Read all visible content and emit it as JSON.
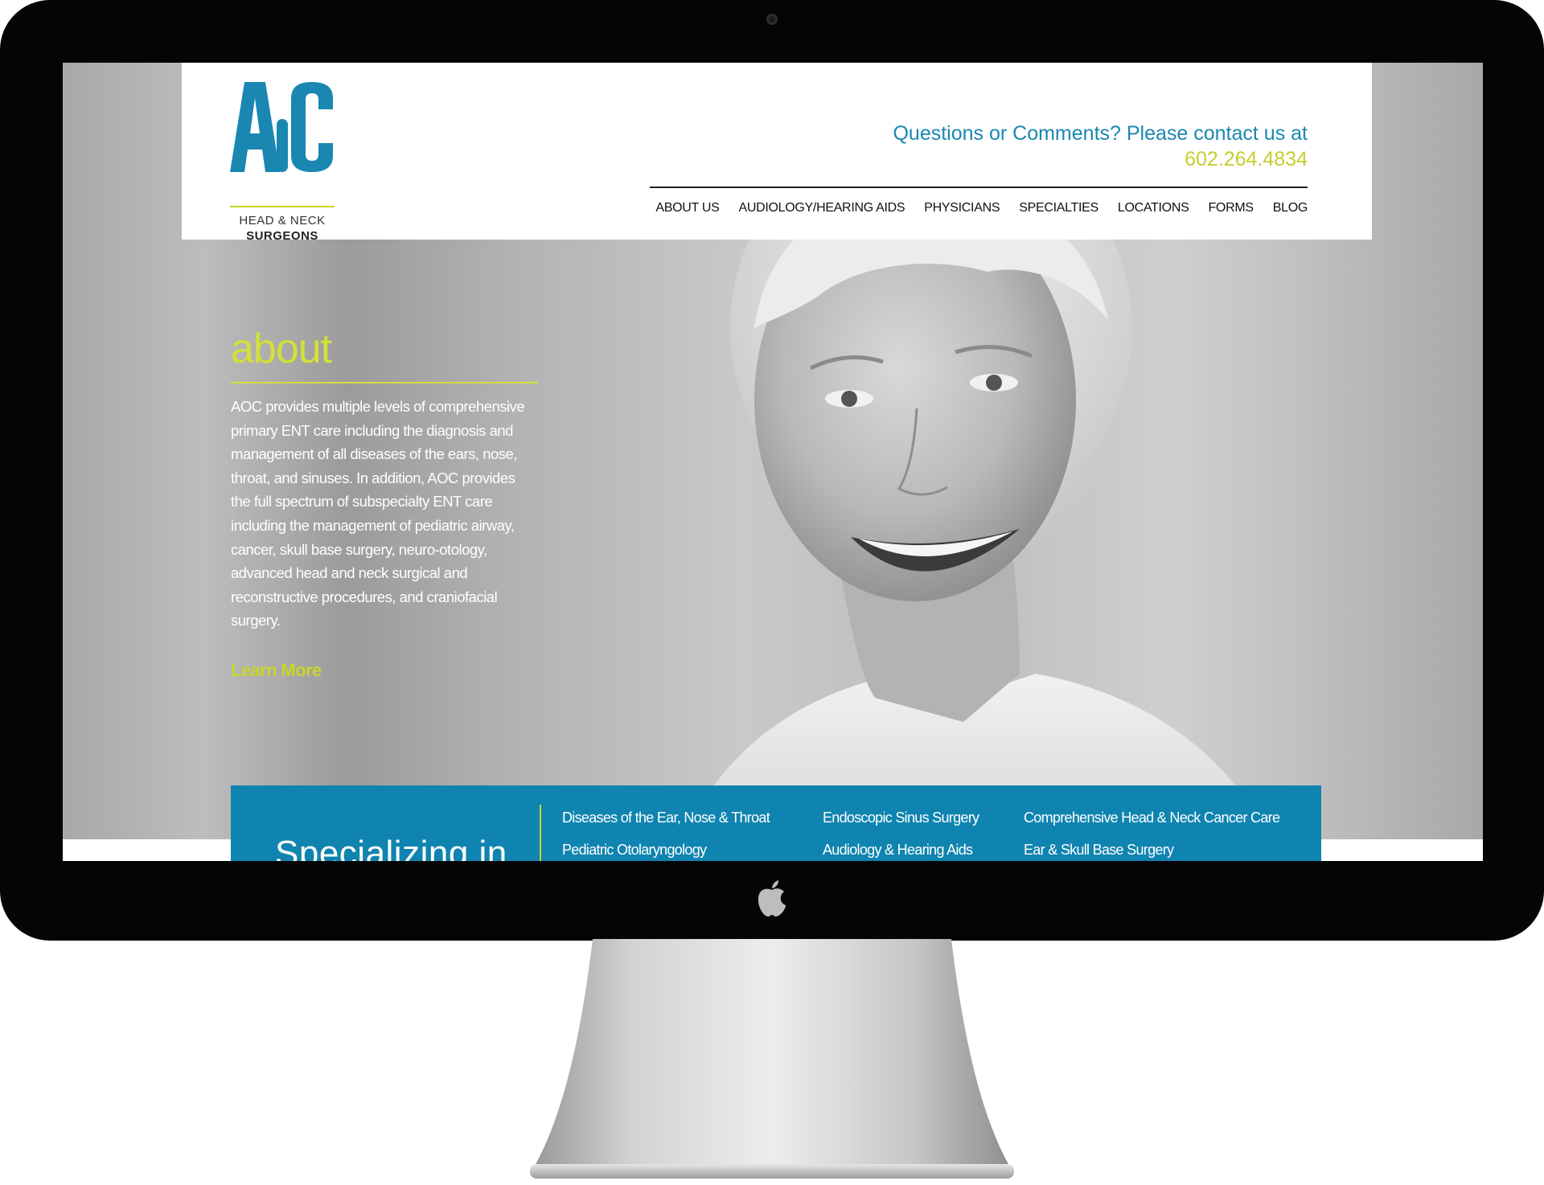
{
  "logo": {
    "mark": "AOC",
    "line1": "HEAD & NECK",
    "line2": "SURGEONS"
  },
  "contact": {
    "question": "Questions or Comments? Please contact us at",
    "phone": "602.264.4834"
  },
  "nav": [
    {
      "label": "ABOUT US"
    },
    {
      "label": "AUDIOLOGY/HEARING AIDS"
    },
    {
      "label": "PHYSICIANS"
    },
    {
      "label": "SPECIALTIES"
    },
    {
      "label": "LOCATIONS"
    },
    {
      "label": "FORMS"
    },
    {
      "label": "BLOG"
    }
  ],
  "about": {
    "title": "about",
    "body": "AOC provides multiple levels of comprehensive primary ENT care including the diagnosis and management of all diseases of the ears, nose, throat, and sinuses. In addition, AOC provides the full spectrum of subspecialty ENT care including the management of pediatric airway, cancer, skull base surgery, neuro-otology, advanced head and neck surgical and reconstructive procedures, and craniofacial surgery.",
    "link": "Learn More"
  },
  "specializing": {
    "heading": "Specializing in",
    "links": [
      "Diseases of the Ear, Nose & Throat",
      "Endoscopic Sinus Surgery",
      "Comprehensive Head & Neck Cancer Care",
      "Pediatric Otolaryngology",
      "Audiology & Hearing Aids",
      "Ear & Skull Base Surgery"
    ]
  },
  "colors": {
    "brand_blue": "#1a87b2",
    "accent_lime": "#c8d62b",
    "bezel": "#050505"
  },
  "icons": [
    "camera-icon",
    "apple-logo-icon"
  ]
}
